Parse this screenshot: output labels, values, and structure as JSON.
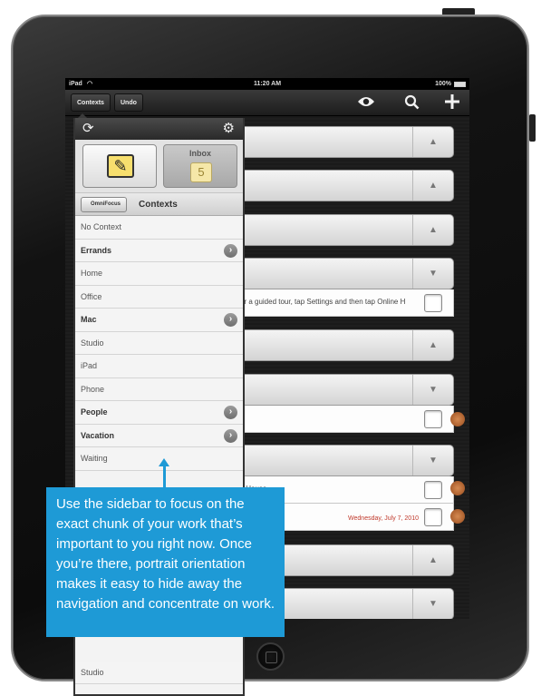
{
  "status_bar": {
    "carrier": "iPad",
    "time": "11:20 AM",
    "battery": "100%"
  },
  "toolbar": {
    "contexts_label": "Contexts",
    "undo_label": "Undo"
  },
  "rows": {
    "r4_text": "or a guided tour, tap Settings and then tap Online H",
    "r7_text": "y House",
    "r7b_date": "Wednesday, July 7, 2010"
  },
  "sidebar": {
    "inbox_label": "Inbox",
    "inbox_count": "5",
    "back_label": "OmniFocus",
    "title": "Contexts",
    "items": [
      {
        "label": "No Context"
      },
      {
        "label": "Errands"
      },
      {
        "label": "Home"
      },
      {
        "label": "Office"
      },
      {
        "label": "Mac"
      },
      {
        "label": "Studio"
      },
      {
        "label": "iPad"
      },
      {
        "label": "Phone"
      },
      {
        "label": "People"
      },
      {
        "label": "Vacation"
      },
      {
        "label": "Waiting"
      },
      {
        "label": "Studio"
      }
    ]
  },
  "callout": {
    "text": "Use the sidebar to focus on the exact chunk of your work that’s important to you right now. Once you’re there, portrait orientation makes it easy to hide away the navigation and concentrate on work."
  },
  "colors": {
    "callout": "#1e9ad6",
    "flag": "#b8612c",
    "date": "#c0392b"
  }
}
